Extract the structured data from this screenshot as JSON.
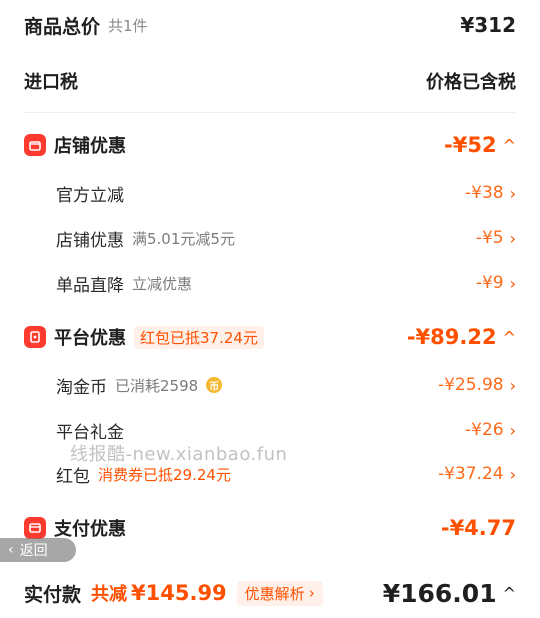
{
  "summary": {
    "title": "商品总价",
    "count": "共1件",
    "amount": "¥312"
  },
  "tax": {
    "label": "进口税",
    "value": "价格已含税"
  },
  "store_discount": {
    "label": "店铺优惠",
    "amount": "-¥52",
    "items": [
      {
        "label": "官方立减",
        "note": "",
        "amount": "-¥38"
      },
      {
        "label": "店铺优惠",
        "note": "满5.01元减5元",
        "amount": "-¥5"
      },
      {
        "label": "单品直降",
        "note": "立减优惠",
        "amount": "-¥9"
      }
    ]
  },
  "platform_discount": {
    "label": "平台优惠",
    "chip": "红包已抵37.24元",
    "amount": "-¥89.22",
    "items": [
      {
        "label": "淘金币",
        "note": "已消耗2598",
        "amount": "-¥25.98"
      },
      {
        "label": "平台礼金",
        "note": "",
        "amount": "-¥26"
      },
      {
        "label": "红包",
        "note": "消费券已抵29.24元",
        "amount": "-¥37.24"
      }
    ]
  },
  "payment_discount": {
    "label": "支付优惠",
    "amount": "-¥4.77"
  },
  "footer": {
    "pay_label": "实付款",
    "saved_label": "共减",
    "saved_amount": "¥145.99",
    "analyze_label": "优惠解析",
    "total": "¥166.01"
  },
  "overlay": {
    "back_label": "返回",
    "watermark": "线报酷-new.xianbao.fun"
  },
  "colors": {
    "accent": "#ff5000",
    "icon_red": "#ff3a2f"
  },
  "icons": {
    "store": "store-icon",
    "platform": "red-packet-icon",
    "payment": "card-icon",
    "coin": "coin-icon"
  }
}
